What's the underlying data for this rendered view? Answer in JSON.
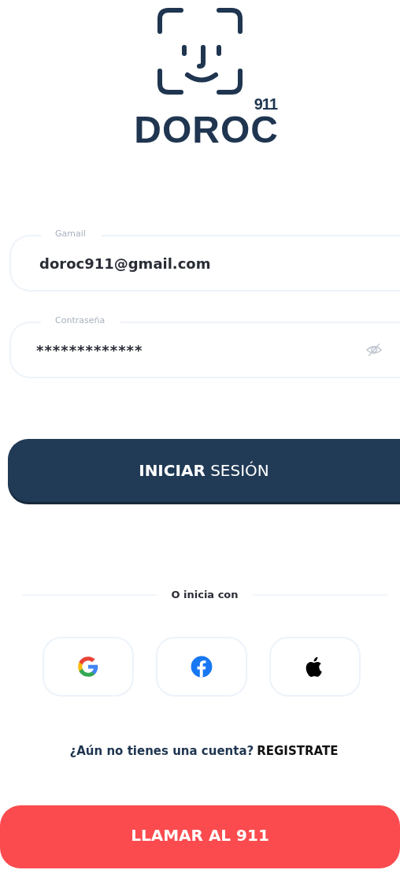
{
  "logo": {
    "number": "911",
    "name": "DOROC"
  },
  "fields": [
    {
      "kind": "email",
      "label": "Gamail",
      "value": "doroc911@gmail.com"
    },
    {
      "kind": "password",
      "label": "Contraseña",
      "value": "*************"
    }
  ],
  "login_button": "**INICIAR** SESIÓN",
  "divider_text": "O inicia con",
  "social_buttons": [
    {
      "kind": "google"
    },
    {
      "kind": "facebook"
    },
    {
      "kind": "apple"
    }
  ],
  "register": {
    "question": "¿Aún no tienes una cuenta?",
    "link": "REGISTRATE"
  },
  "call_button": "LLAMAR AL 911"
}
